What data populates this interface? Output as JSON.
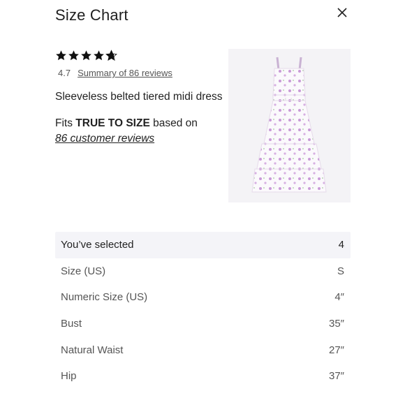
{
  "modal": {
    "title": "Size Chart",
    "close_icon": "close-icon"
  },
  "rating": {
    "stars": 4.7,
    "value_label": "4.7",
    "summary_link": "Summary of 86 reviews"
  },
  "product": {
    "name": "Sleeveless belted tiered midi dress",
    "image_icon": "dress-photo",
    "fit_prefix": "Fits ",
    "fit_value": "TRUE TO SIZE",
    "fit_suffix": " based on",
    "fit_reviews_link": "86 customer reviews"
  },
  "size_table": {
    "rows": [
      {
        "label": "You’ve selected",
        "value": "4"
      },
      {
        "label": "Size (US)",
        "value": "S"
      },
      {
        "label": "Numeric Size (US)",
        "value": "4″"
      },
      {
        "label": "Bust",
        "value": "35″"
      },
      {
        "label": "Natural Waist",
        "value": "27″"
      },
      {
        "label": "Hip",
        "value": "37″"
      }
    ]
  },
  "colors": {
    "selected_row_bg": "#f4f4f8",
    "text_primary": "#1f1f1f",
    "text_secondary": "#555555",
    "dress_print": "#c99ad8"
  }
}
